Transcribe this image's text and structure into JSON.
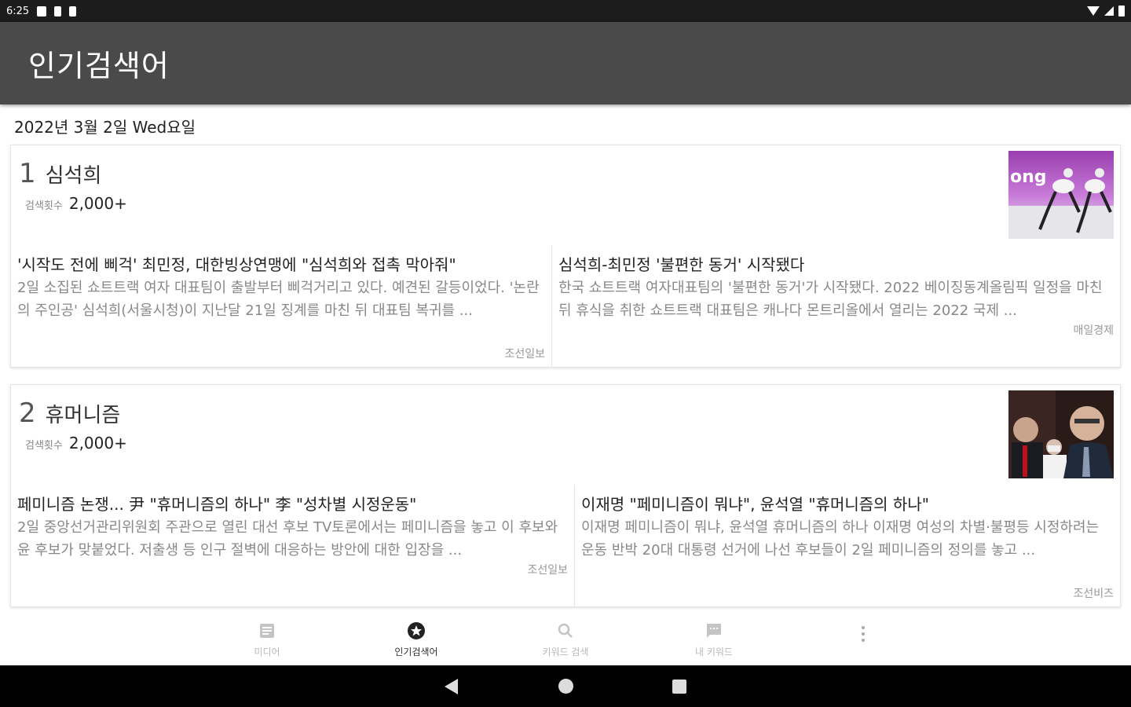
{
  "status_bar": {
    "time": "6:25"
  },
  "app_bar": {
    "title": "인기검색어"
  },
  "date_line": "2022년 3월 2일 Wed요일",
  "trends": [
    {
      "rank": "1",
      "keyword": "심석희",
      "count_label": "검색횟수",
      "count": "2,000+",
      "articles": [
        {
          "title": "'시작도 전에 삐걱' 최민정, 대한빙상연맹에 \"심석희와 접촉 막아줘\"",
          "snippet": "2일 소집된 쇼트트랙 여자 대표팀이 출발부터 삐걱거리고 있다. 예견된 갈등이었다. '논란의 주인공' 심석희(서울시청)이 지난달 21일 징계를 마친 뒤 대표팀 복귀를 ...",
          "source": "조선일보"
        },
        {
          "title": "심석희-최민정 '불편한 동거' 시작됐다",
          "snippet": "한국 쇼트트랙 여자대표팀의 '불편한 동거'가 시작됐다. 2022 베이징동계올림픽 일정을 마친 뒤 휴식을 취한 쇼트트랙 대표팀은 캐나다 몬트리올에서 열리는 2022 국제 ...",
          "source": "매일경제"
        }
      ]
    },
    {
      "rank": "2",
      "keyword": "휴머니즘",
      "count_label": "검색횟수",
      "count": "2,000+",
      "articles": [
        {
          "title": "페미니즘 논쟁... 尹 \"휴머니즘의 하나\" 李 \"성차별 시정운동\"",
          "snippet": "2일 중앙선거관리위원회 주관으로 열린 대선 후보 TV토론에서는 페미니즘을 놓고 이 후보와 윤 후보가 맞붙었다. 저출생 등 인구 절벽에 대응하는 방안에 대한 입장을 ...",
          "source": "조선일보"
        },
        {
          "title": "이재명 \"페미니즘이 뭐냐\", 윤석열 \"휴머니즘의 하나\"",
          "snippet": "이재명 페미니즘이 뭐냐, 윤석열 휴머니즘의 하나 이재명 여성의 차별·불평등 시정하려는 운동 반박 20대 대통령 선거에 나선 후보들이 2일 페미니즘의 정의를 놓고 ...",
          "source": "조선비즈"
        }
      ]
    }
  ],
  "bottom_nav": [
    {
      "label": "미디어",
      "icon": "article-icon",
      "active": false
    },
    {
      "label": "인기검색어",
      "icon": "star-icon",
      "active": true
    },
    {
      "label": "키워드 검색",
      "icon": "search-icon",
      "active": false
    },
    {
      "label": "내 키워드",
      "icon": "chat-icon",
      "active": false
    }
  ],
  "colors": {
    "app_bar": "#4a4a4a",
    "status_bar": "#1c1c1c",
    "active_nav": "#333333",
    "inactive_nav": "#b8b8b8"
  }
}
